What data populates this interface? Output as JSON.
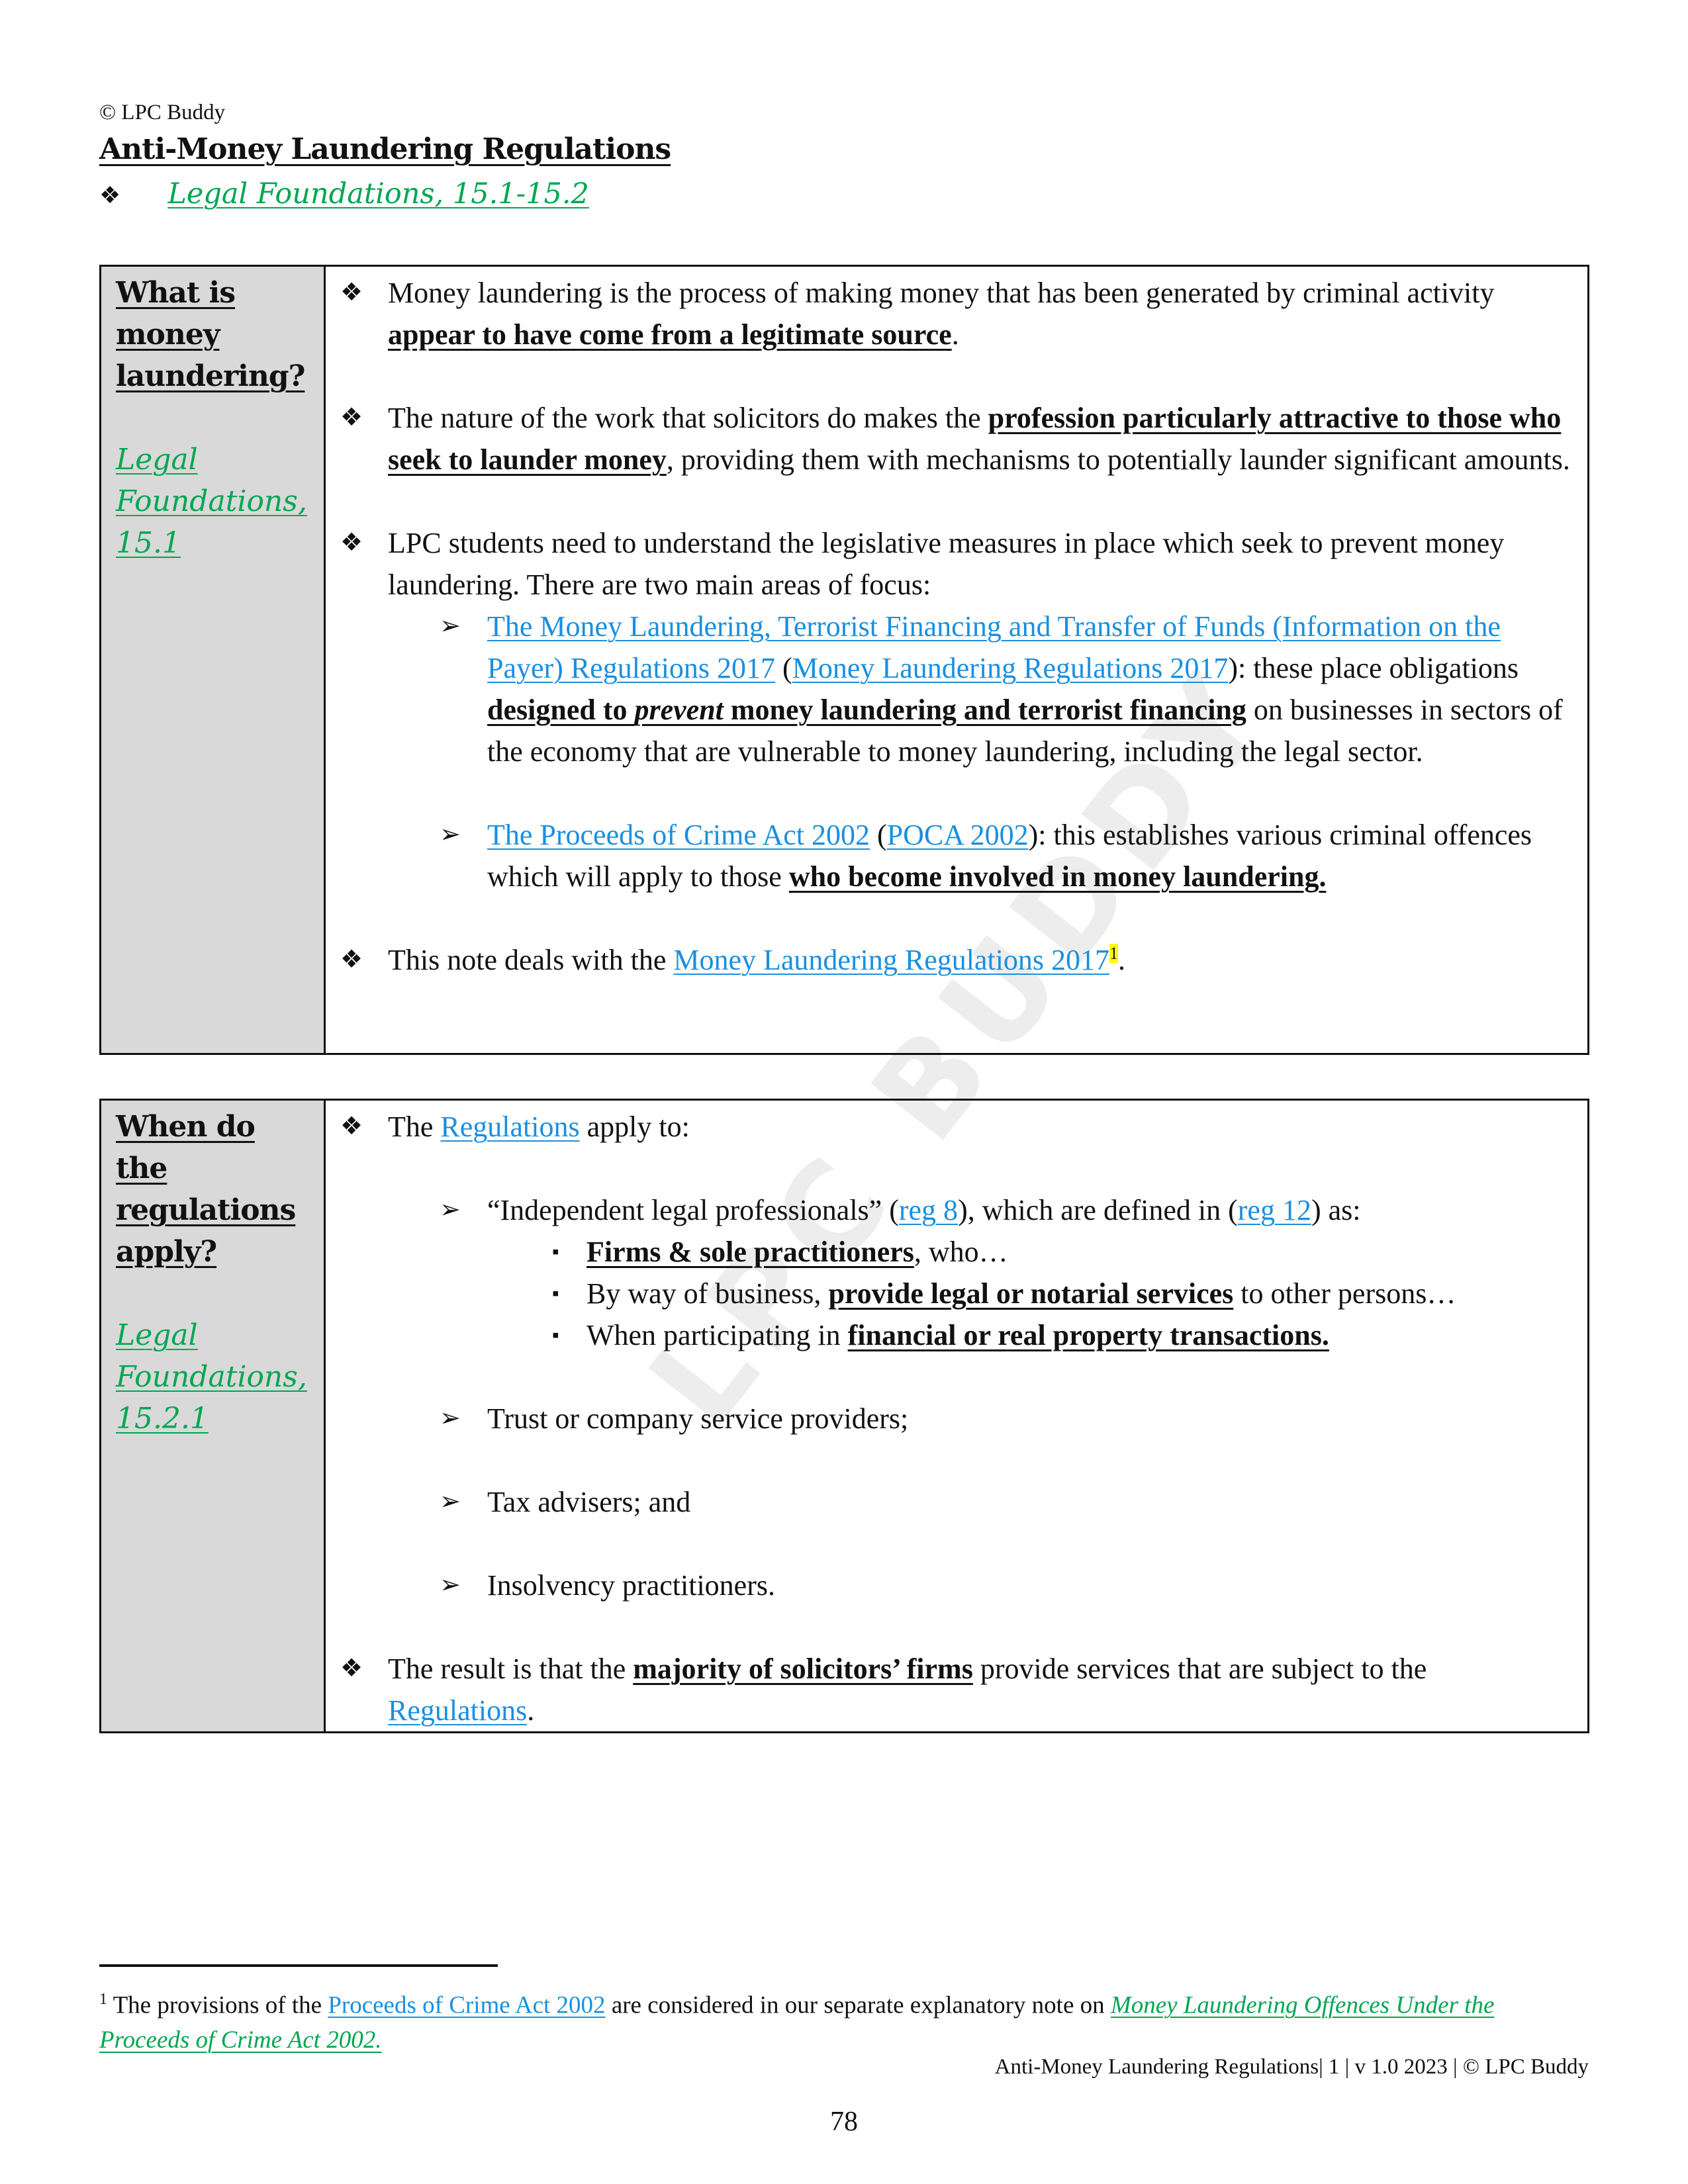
{
  "header": {
    "copyright": "© LPC Buddy",
    "title": "Anti-Money Laundering Regulations",
    "reference_link": "Legal Foundations, 15.1-15.2"
  },
  "watermark": "LPC BUDDY",
  "sections": [
    {
      "question": [
        "What is",
        "money",
        "laundering?"
      ],
      "reference": [
        "Legal",
        "Foundations,",
        "15.1"
      ],
      "bullets": {
        "b1_pre": "Money laundering is the process of making money that has been generated by criminal activity ",
        "b1_bold": "appear to have come from a legitimate source",
        "b1_post": ".",
        "b2_pre": "The nature of the work that solicitors do makes the ",
        "b2_bold": "profession particularly attractive to those who seek to launder money",
        "b2_post": ", providing them with mechanisms to potentially launder significant amounts.",
        "b3": "LPC students need to understand the legislative measures in place which seek to prevent money laundering. There are two main areas of focus:",
        "sub1_link1": "The Money Laundering, Terrorist Financing and Transfer of Funds (Information on the Payer) Regulations 2017",
        "sub1_paren_open": " (",
        "sub1_link2": "Money Laundering Regulations 2017",
        "sub1_mid": "): these place obligations ",
        "sub1_bold_a": "designed to ",
        "sub1_bold_italic": "prevent",
        "sub1_bold_b": " money laundering and terrorist financing",
        "sub1_post": " on businesses in sectors of the economy that are vulnerable to money laundering, including the legal sector.",
        "sub2_link1": "The Proceeds of Crime Act 2002",
        "sub2_paren_open": " (",
        "sub2_link2": "POCA 2002",
        "sub2_mid": "): this establishes various criminal offences which will apply to those ",
        "sub2_bold": "who become involved in money laundering.",
        "b4_pre": "This note deals with the ",
        "b4_link": "Money Laundering Regulations 2017",
        "b4_footnote_ref": "1",
        "b4_post": "."
      }
    },
    {
      "question": [
        "When do",
        "the",
        "regulations",
        "apply?"
      ],
      "reference": [
        "Legal",
        "Foundations,",
        "15.2.1"
      ],
      "bullets": {
        "b1_pre": "The ",
        "b1_link": "Regulations",
        "b1_post": " apply to:",
        "sub1_pre": "“Independent legal professionals” (",
        "sub1_link1": "reg 8",
        "sub1_mid": "), which are defined in (",
        "sub1_link2": "reg 12",
        "sub1_post": ") as:",
        "sq1_bold": "Firms & sole practitioners",
        "sq1_post": ", who…",
        "sq2_pre": "By way of business, ",
        "sq2_bold": "provide legal or notarial services",
        "sq2_post": " to other persons…",
        "sq3_pre": "When participating in ",
        "sq3_bold": "financial or real property transactions.",
        "sub2": "Trust or company service providers;",
        "sub3": "Tax advisers; and",
        "sub4": "Insolvency practitioners.",
        "b2_pre": "The result is that the ",
        "b2_bold": "majority of solicitors’ firms",
        "b2_mid": " provide services that are subject to the ",
        "b2_link": "Regulations",
        "b2_post": "."
      }
    }
  ],
  "footnote": {
    "number": "1",
    "pre": " The provisions of the ",
    "link": "Proceeds of Crime Act 2002",
    "mid": " are considered in our separate explanatory note on ",
    "green_link": "Money Laundering Offences Under the Proceeds of Crime Act 2002."
  },
  "footer": {
    "running_title": "Anti-Money Laundering Regulations| 1 | v 1.0 2023 | © LPC Buddy",
    "page_number": "78"
  },
  "icons": {
    "level1": "❖",
    "level2": "➢",
    "level3": "▪"
  }
}
